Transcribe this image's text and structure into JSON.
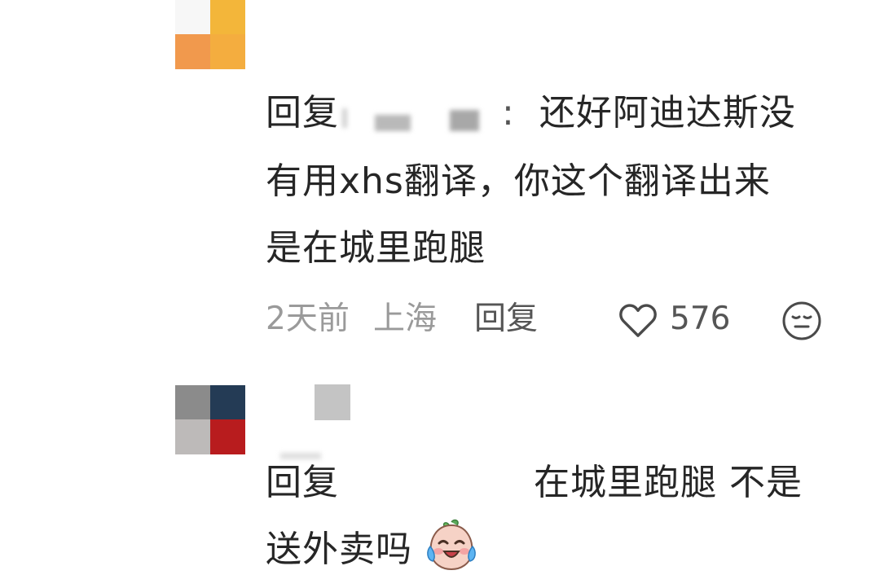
{
  "comment1": {
    "reply_prefix": "回复",
    "colon": ":",
    "line1": "还好阿迪达斯没",
    "line2": "有用xhs翻译，你这个翻译出来",
    "line3": "是在城里跑腿",
    "time": "2天前",
    "location": "上海",
    "reply_button": "回复",
    "like_count": "576"
  },
  "comment2": {
    "reply_prefix": "回复",
    "line1": "在城里跑腿 不是",
    "line2": "送外卖吗"
  },
  "icons": {
    "like": "heart-icon",
    "reaction": "neutral-face-icon",
    "emoji": "crying-laughing-emoji"
  },
  "colors": {
    "text": "#262626",
    "meta_text": "#9a9a9a",
    "reply_button": "#555555",
    "avatar1": [
      "#ffffff",
      "#f3b63a",
      "#f1994d",
      "#f4ad3f"
    ],
    "avatar2": [
      "#8b8b8b",
      "#243b55",
      "#bdbab9",
      "#b81c1e"
    ]
  }
}
